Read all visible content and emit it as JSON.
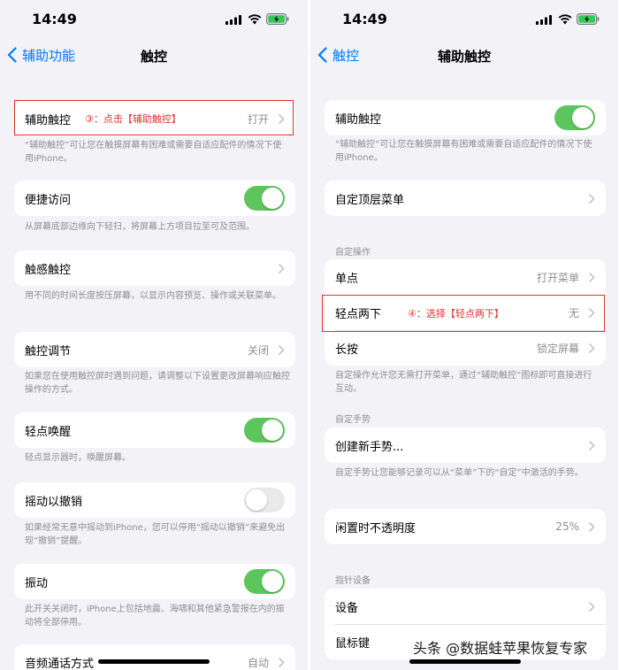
{
  "left": {
    "status_time": "14:49",
    "back_label": "辅助功能",
    "title": "触控",
    "rows": {
      "assistive_touch": {
        "label": "辅助触控",
        "value": "打开"
      },
      "reachability": {
        "label": "便捷访问"
      },
      "haptic_touch": {
        "label": "触感触控"
      },
      "touch_accommodations": {
        "label": "触控调节",
        "value": "关闭"
      },
      "tap_to_wake": {
        "label": "轻点唤醒"
      },
      "shake_to_undo": {
        "label": "摇动以撤销"
      },
      "vibration": {
        "label": "振动"
      },
      "call_audio": {
        "label": "音频通话方式",
        "value": "自动"
      }
    },
    "footers": {
      "assistive_touch": "“辅助触控”可让您在触摸屏幕有困难或需要自适应配件的情况下使用iPhone。",
      "reachability": "从屏幕底部边缘向下轻扫，将屏幕上方项目拉至可及范围。",
      "haptic_touch": "用不同的时间长度按压屏幕，以显示内容预览、操作或关联菜单。",
      "touch_accommodations": "如果您在使用触控屏时遇到问题，请调整以下设置更改屏幕响应触控操作的方式。",
      "tap_to_wake": "轻点显示器时，唤醒屏幕。",
      "shake_to_undo": "如果经常无意中摇动到iPhone，您可以停用“摇动以撤销”来避免出现“撤销”提醒。",
      "vibration": "此开关关闭时，iPhone上包括地震、海啸和其他紧急警报在内的振动将全部停用。"
    },
    "annotation": "③：点击【辅助触控】"
  },
  "right": {
    "status_time": "14:49",
    "back_label": "触控",
    "title": "辅助触控",
    "rows": {
      "assistive_touch": {
        "label": "辅助触控"
      },
      "customize_menu": {
        "label": "自定顶层菜单"
      },
      "single_tap": {
        "label": "单点",
        "value": "打开菜单"
      },
      "double_tap": {
        "label": "轻点两下",
        "value": "无"
      },
      "long_press": {
        "label": "长按",
        "value": "锁定屏幕"
      },
      "create_gesture": {
        "label": "创建新手势..."
      },
      "idle_opacity": {
        "label": "闲置时不透明度",
        "value": "25%"
      },
      "devices": {
        "label": "设备"
      },
      "mouse_keys": {
        "label": "鼠标键"
      }
    },
    "sections": {
      "custom_actions": "自定操作",
      "custom_gestures": "自定手势",
      "pointer_devices": "指针设备"
    },
    "footers": {
      "assistive_touch": "“辅助触控”可让您在触摸屏幕有困难或需要自适应配件的情况下使用iPhone。",
      "custom_actions": "自定操作允许您无需打开菜单，通过“辅助触控”图标即可直接进行互动。",
      "custom_gestures": "自定手势让您能够记录可以从“菜单”下的“自定”中激活的手势。"
    },
    "annotation": "④：选择【轻点两下】"
  },
  "toggles": {
    "reachability": true,
    "tap_to_wake": true,
    "shake_to_undo": false,
    "vibration": true,
    "assistive_touch": true
  },
  "watermark": "头条 @数据蛙苹果恢复专家",
  "colors": {
    "accent": "#007aff",
    "toggle_on": "#5cc65c",
    "annotation_red": "#e0322f",
    "background": "#f2f2f7"
  }
}
